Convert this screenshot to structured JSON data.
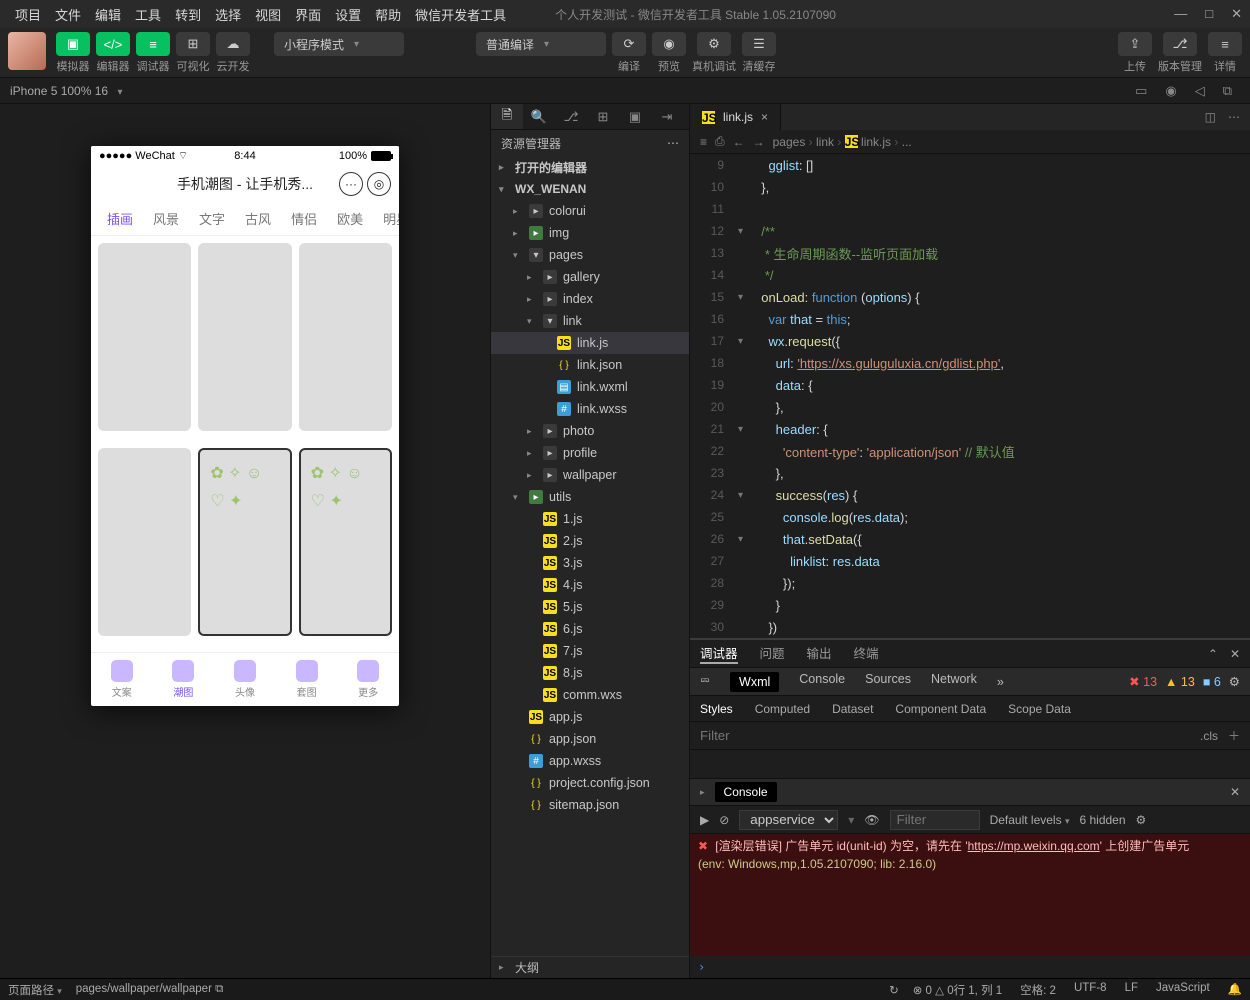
{
  "menu": {
    "items": [
      "项目",
      "文件",
      "编辑",
      "工具",
      "转到",
      "选择",
      "视图",
      "界面",
      "设置",
      "帮助",
      "微信开发者工具"
    ],
    "title": "个人开发测试 - 微信开发者工具 Stable 1.05.2107090"
  },
  "window_controls": {
    "min": "—",
    "max": "□",
    "close": "✕"
  },
  "toolbar": {
    "labels": {
      "sim": "模拟器",
      "editor": "编辑器",
      "debugger": "调试器",
      "visual": "可视化",
      "cloud": "云开发"
    },
    "mode_select": "小程序模式",
    "compile_select": "普通编译",
    "actions": {
      "compile": "编译",
      "preview": "预览",
      "remote": "真机调试",
      "clear": "清缓存"
    },
    "right": {
      "upload": "上传",
      "version": "版本管理",
      "detail": "详情"
    }
  },
  "sim": {
    "device": "iPhone 5 100% 16",
    "status": {
      "left": "●●●●● WeChat",
      "wifi": "⌔",
      "time": "8:44",
      "pct": "100%"
    },
    "app_title": "手机潮图 - 让手机秀...",
    "tabs": [
      "插画",
      "风景",
      "文字",
      "古风",
      "情侣",
      "欧美",
      "明星"
    ],
    "active_tab": 0,
    "bottom": [
      "文案",
      "潮图",
      "头像",
      "套图",
      "更多"
    ],
    "bottom_active": 1
  },
  "explorer": {
    "header": "资源管理器",
    "sections": {
      "open_editors": "打开的编辑器",
      "root": "WX_WENAN",
      "outline": "大纲"
    },
    "tree": [
      {
        "d": 1,
        "t": "folder",
        "n": "colorui"
      },
      {
        "d": 1,
        "t": "folder-g",
        "n": "img"
      },
      {
        "d": 1,
        "t": "folder-o",
        "n": "pages",
        "open": true
      },
      {
        "d": 2,
        "t": "folder",
        "n": "gallery"
      },
      {
        "d": 2,
        "t": "folder",
        "n": "index"
      },
      {
        "d": 2,
        "t": "folder-o",
        "n": "link",
        "open": true
      },
      {
        "d": 3,
        "t": "js",
        "n": "link.js",
        "sel": true
      },
      {
        "d": 3,
        "t": "json",
        "n": "link.json"
      },
      {
        "d": 3,
        "t": "wxml",
        "n": "link.wxml"
      },
      {
        "d": 3,
        "t": "wxss",
        "n": "link.wxss"
      },
      {
        "d": 2,
        "t": "folder",
        "n": "photo"
      },
      {
        "d": 2,
        "t": "folder",
        "n": "profile"
      },
      {
        "d": 2,
        "t": "folder",
        "n": "wallpaper"
      },
      {
        "d": 1,
        "t": "folder-g",
        "n": "utils",
        "open": true
      },
      {
        "d": 2,
        "t": "js",
        "n": "1.js"
      },
      {
        "d": 2,
        "t": "js",
        "n": "2.js"
      },
      {
        "d": 2,
        "t": "js",
        "n": "3.js"
      },
      {
        "d": 2,
        "t": "js",
        "n": "4.js"
      },
      {
        "d": 2,
        "t": "js",
        "n": "5.js"
      },
      {
        "d": 2,
        "t": "js",
        "n": "6.js"
      },
      {
        "d": 2,
        "t": "js",
        "n": "7.js"
      },
      {
        "d": 2,
        "t": "js",
        "n": "8.js"
      },
      {
        "d": 2,
        "t": "js",
        "n": "comm.wxs"
      },
      {
        "d": 1,
        "t": "js",
        "n": "app.js"
      },
      {
        "d": 1,
        "t": "json",
        "n": "app.json"
      },
      {
        "d": 1,
        "t": "wxss",
        "n": "app.wxss"
      },
      {
        "d": 1,
        "t": "json",
        "n": "project.config.json"
      },
      {
        "d": 1,
        "t": "json",
        "n": "sitemap.json"
      }
    ]
  },
  "editor": {
    "tab_name": "link.js",
    "breadcrumb": [
      "pages",
      "link",
      "link.js",
      "..."
    ],
    "first_line_no": 9,
    "lines": [
      {
        "f": "",
        "h": "    <span class='tok-var'>gglist</span><span class='tok-pun'>: []</span>"
      },
      {
        "f": "",
        "h": "  <span class='tok-pun'>},</span>"
      },
      {
        "f": "",
        "h": ""
      },
      {
        "f": "▾",
        "h": "  <span class='tok-com'>/**</span>"
      },
      {
        "f": "",
        "h": "  <span class='tok-com'> * 生命周期函数--监听页面加载</span>"
      },
      {
        "f": "",
        "h": "  <span class='tok-com'> */</span>"
      },
      {
        "f": "▾",
        "h": "  <span class='tok-fn'>onLoad</span><span class='tok-pun'>: </span><span class='tok-key'>function</span> <span class='tok-pun'>(</span><span class='tok-var'>options</span><span class='tok-pun'>) {</span>"
      },
      {
        "f": "",
        "h": "    <span class='tok-key'>var</span> <span class='tok-var'>that</span> <span class='tok-pun'>= </span><span class='tok-this'>this</span><span class='tok-pun'>;</span>"
      },
      {
        "f": "▾",
        "h": "    <span class='tok-var'>wx</span><span class='tok-pun'>.</span><span class='tok-fn'>request</span><span class='tok-pun'>({</span>"
      },
      {
        "f": "",
        "h": "      <span class='tok-var'>url</span><span class='tok-pun'>: </span><span class='tok-url'>'https://xs.guluguluxia.cn/gdlist.php'</span><span class='tok-pun'>,</span>"
      },
      {
        "f": "",
        "h": "      <span class='tok-var'>data</span><span class='tok-pun'>: {</span>"
      },
      {
        "f": "",
        "h": "      <span class='tok-pun'>},</span>"
      },
      {
        "f": "▾",
        "h": "      <span class='tok-var'>header</span><span class='tok-pun'>: {</span>"
      },
      {
        "f": "",
        "h": "        <span class='tok-str'>'content-type'</span><span class='tok-pun'>: </span><span class='tok-str'>'application/json'</span> <span class='tok-com'>// 默认值</span>"
      },
      {
        "f": "",
        "h": "      <span class='tok-pun'>},</span>"
      },
      {
        "f": "▾",
        "h": "      <span class='tok-fn'>success</span><span class='tok-pun'>(</span><span class='tok-var'>res</span><span class='tok-pun'>) {</span>"
      },
      {
        "f": "",
        "h": "        <span class='tok-var'>console</span><span class='tok-pun'>.</span><span class='tok-fn'>log</span><span class='tok-pun'>(</span><span class='tok-var'>res</span><span class='tok-pun'>.</span><span class='tok-var'>data</span><span class='tok-pun'>);</span>"
      },
      {
        "f": "▾",
        "h": "        <span class='tok-var'>that</span><span class='tok-pun'>.</span><span class='tok-fn'>setData</span><span class='tok-pun'>({</span>"
      },
      {
        "f": "",
        "h": "          <span class='tok-var'>linklist</span><span class='tok-pun'>: </span><span class='tok-var'>res</span><span class='tok-pun'>.</span><span class='tok-var'>data</span>"
      },
      {
        "f": "",
        "h": "        <span class='tok-pun'>});</span>"
      },
      {
        "f": "",
        "h": "      <span class='tok-pun'>}</span>"
      },
      {
        "f": "",
        "h": "    <span class='tok-pun'>})</span>"
      }
    ]
  },
  "debugger": {
    "tabs": [
      "调试器",
      "问题",
      "输出",
      "终端"
    ],
    "devtabs": [
      "Wxml",
      "Console",
      "Sources",
      "Network"
    ],
    "devtabs_more": "»",
    "badges": {
      "err": "13",
      "warn": "13",
      "info": "6"
    },
    "styletabs": [
      "Styles",
      "Computed",
      "Dataset",
      "Component Data",
      "Scope Data"
    ],
    "filter_placeholder": "Filter",
    "cls_label": ".cls",
    "console_label": "Console",
    "appservice": "appservice",
    "filter2_placeholder": "Filter",
    "levels": "Default levels",
    "hidden": "6 hidden",
    "log_line1": "[渲染层错误] 广告单元 id(unit-id) 为空，请先在 '",
    "log_url": "https://mp.weixin.qq.com",
    "log_line1b": "' 上创建广告单元",
    "log_line2": "(env: Windows,mp,1.05.2107090; lib: 2.16.0)"
  },
  "status": {
    "left_label": "页面路径",
    "path": "pages/wallpaper/wallpaper",
    "problems": {
      "err": "0",
      "warn": "0"
    },
    "right": {
      "pos": "行 1, 列 1",
      "spaces": "空格: 2",
      "enc": "UTF-8",
      "eol": "LF",
      "lang": "JavaScript"
    }
  }
}
